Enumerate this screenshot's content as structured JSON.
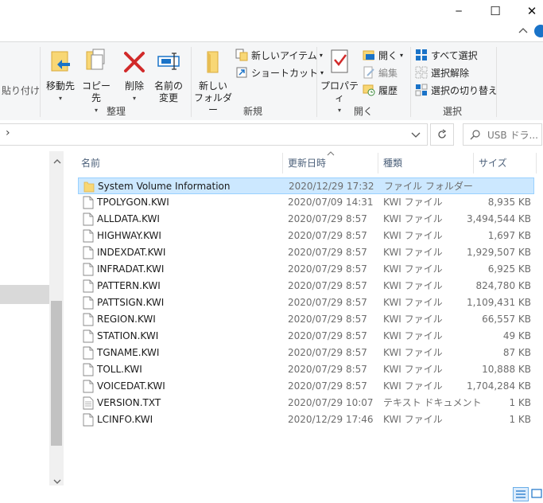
{
  "window": {
    "minimize_glyph": "─",
    "maximize_glyph": "☐",
    "close_glyph": "✕"
  },
  "ribbon": {
    "paste_label": "貼り付け",
    "organize": {
      "group_label": "整理",
      "move_to": "移動先",
      "copy_to": "コピー先",
      "delete": "削除",
      "rename_line1": "名前の",
      "rename_line2": "変更"
    },
    "new": {
      "group_label": "新規",
      "new_folder_line1": "新しい",
      "new_folder_line2": "フォルダー",
      "new_item": "新しいアイテム",
      "shortcut": "ショートカット"
    },
    "open": {
      "group_label": "開く",
      "properties": "プロパティ",
      "open": "開く",
      "edit": "編集",
      "history": "履歴"
    },
    "select": {
      "group_label": "選択",
      "select_all": "すべて選択",
      "select_none": "選択解除",
      "invert": "選択の切り替え"
    }
  },
  "address": {
    "chevron": "›",
    "search_placeholder": "USB ドラ..."
  },
  "columns": {
    "name": "名前",
    "date": "更新日時",
    "type": "種類",
    "size": "サイズ"
  },
  "files": [
    {
      "name": "System Volume Information",
      "date": "2020/12/29 17:32",
      "type": "ファイル フォルダー",
      "size": "",
      "kind": "folder",
      "selected": true
    },
    {
      "name": "TPOLYGON.KWI",
      "date": "2020/07/09 14:31",
      "type": "KWI ファイル",
      "size": "8,935 KB",
      "kind": "file"
    },
    {
      "name": "ALLDATA.KWI",
      "date": "2020/07/29 8:57",
      "type": "KWI ファイル",
      "size": "3,494,544 KB",
      "kind": "file"
    },
    {
      "name": "HIGHWAY.KWI",
      "date": "2020/07/29 8:57",
      "type": "KWI ファイル",
      "size": "1,697 KB",
      "kind": "file"
    },
    {
      "name": "INDEXDAT.KWI",
      "date": "2020/07/29 8:57",
      "type": "KWI ファイル",
      "size": "1,929,507 KB",
      "kind": "file"
    },
    {
      "name": "INFRADAT.KWI",
      "date": "2020/07/29 8:57",
      "type": "KWI ファイル",
      "size": "6,925 KB",
      "kind": "file"
    },
    {
      "name": "PATTERN.KWI",
      "date": "2020/07/29 8:57",
      "type": "KWI ファイル",
      "size": "824,780 KB",
      "kind": "file"
    },
    {
      "name": "PATTSIGN.KWI",
      "date": "2020/07/29 8:57",
      "type": "KWI ファイル",
      "size": "1,109,431 KB",
      "kind": "file"
    },
    {
      "name": "REGION.KWI",
      "date": "2020/07/29 8:57",
      "type": "KWI ファイル",
      "size": "66,557 KB",
      "kind": "file"
    },
    {
      "name": "STATION.KWI",
      "date": "2020/07/29 8:57",
      "type": "KWI ファイル",
      "size": "49 KB",
      "kind": "file"
    },
    {
      "name": "TGNAME.KWI",
      "date": "2020/07/29 8:57",
      "type": "KWI ファイル",
      "size": "87 KB",
      "kind": "file"
    },
    {
      "name": "TOLL.KWI",
      "date": "2020/07/29 8:57",
      "type": "KWI ファイル",
      "size": "10,888 KB",
      "kind": "file"
    },
    {
      "name": "VOICEDAT.KWI",
      "date": "2020/07/29 8:57",
      "type": "KWI ファイル",
      "size": "1,704,284 KB",
      "kind": "file"
    },
    {
      "name": "VERSION.TXT",
      "date": "2020/07/29 10:07",
      "type": "テキスト ドキュメント",
      "size": "1 KB",
      "kind": "text"
    },
    {
      "name": "LCINFO.KWI",
      "date": "2020/12/29 17:46",
      "type": "KWI ファイル",
      "size": "1 KB",
      "kind": "file"
    }
  ],
  "colors": {
    "selection_bg": "#cce8ff",
    "selection_border": "#99d1ff",
    "header_text": "#4c607a",
    "help_icon": "#1a73c8"
  }
}
